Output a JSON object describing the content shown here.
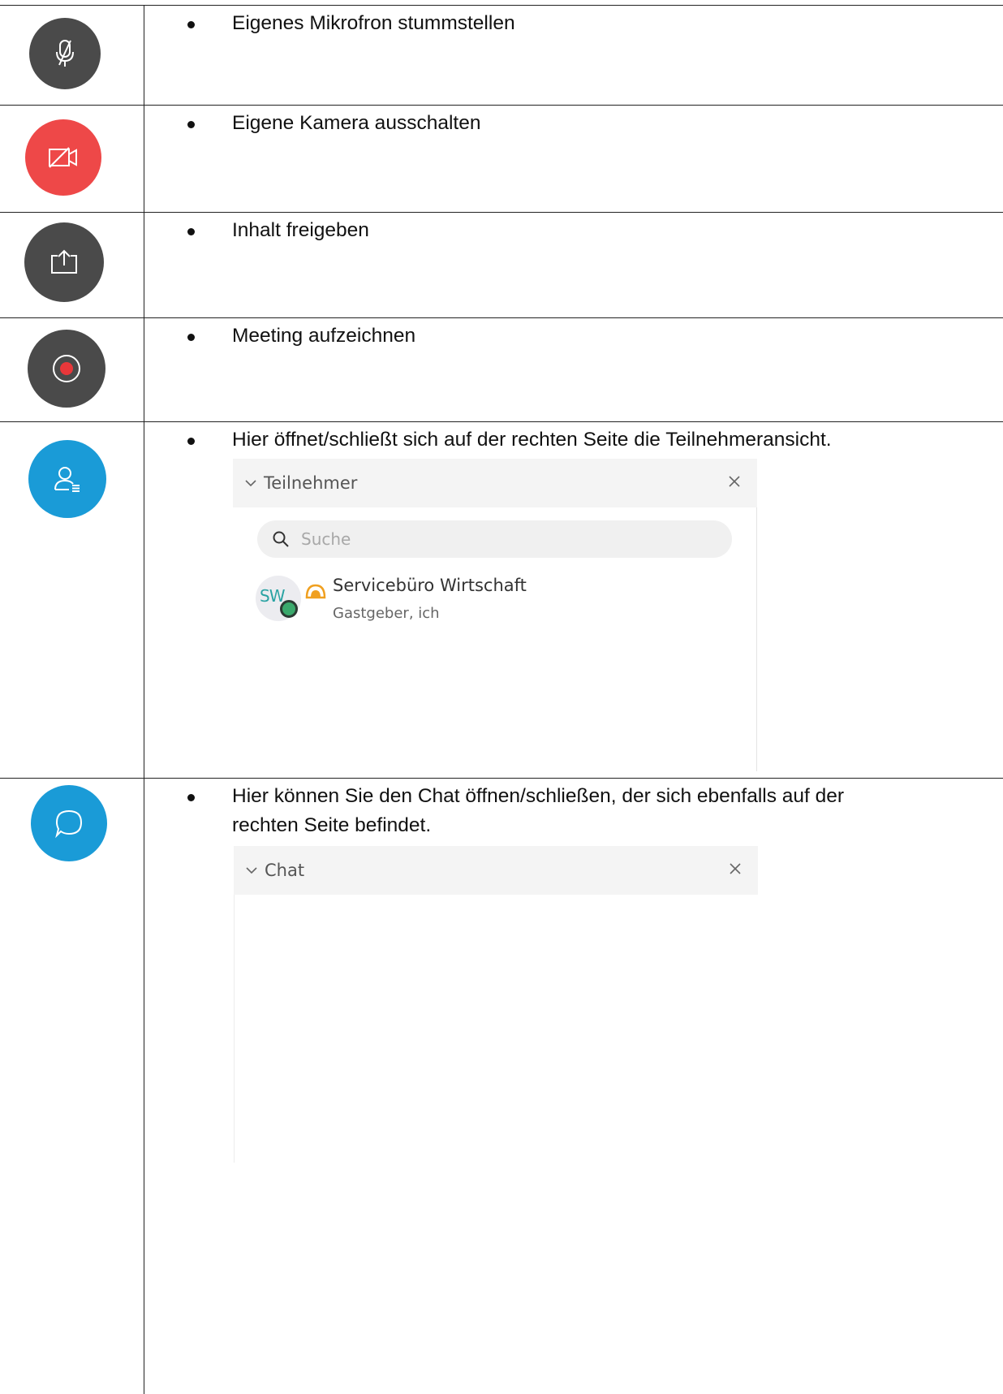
{
  "rows": [
    {
      "icon": "microphone-muted-icon",
      "circle_color": "#4a4a4a",
      "text": "Eigenes Mikrofron stummstellen"
    },
    {
      "icon": "camera-off-icon",
      "circle_color": "#ee4848",
      "text": "Eigene Kamera ausschalten"
    },
    {
      "icon": "share-content-icon",
      "circle_color": "#4a4a4a",
      "text": "Inhalt freigeben"
    },
    {
      "icon": "record-icon",
      "circle_color": "#4a4a4a",
      "text": "Meeting aufzeichnen"
    },
    {
      "icon": "participants-icon",
      "circle_color": "#1a9bd7",
      "text": "Hier öffnet/schließt sich auf der rechten Seite die Teilnehmeransicht."
    },
    {
      "icon": "chat-icon",
      "circle_color": "#1a9bd7",
      "text_line1": "Hier können Sie den Chat öffnen/schließen, der sich ebenfalls auf der",
      "text_line2": "rechten Seite befindet."
    }
  ],
  "participants_panel": {
    "title": "Teilnehmer",
    "search_placeholder": "Suche",
    "participant": {
      "initials": "SW",
      "name": "Servicebüro Wirtschaft",
      "role": "Gastgeber, ich"
    }
  },
  "chat_panel": {
    "title": "Chat"
  },
  "colors": {
    "dark_button": "#4a4a4a",
    "red_button": "#ee4848",
    "blue_button": "#1a9bd7",
    "record_dot": "#e8373a",
    "host_icon": "#f0a020"
  }
}
